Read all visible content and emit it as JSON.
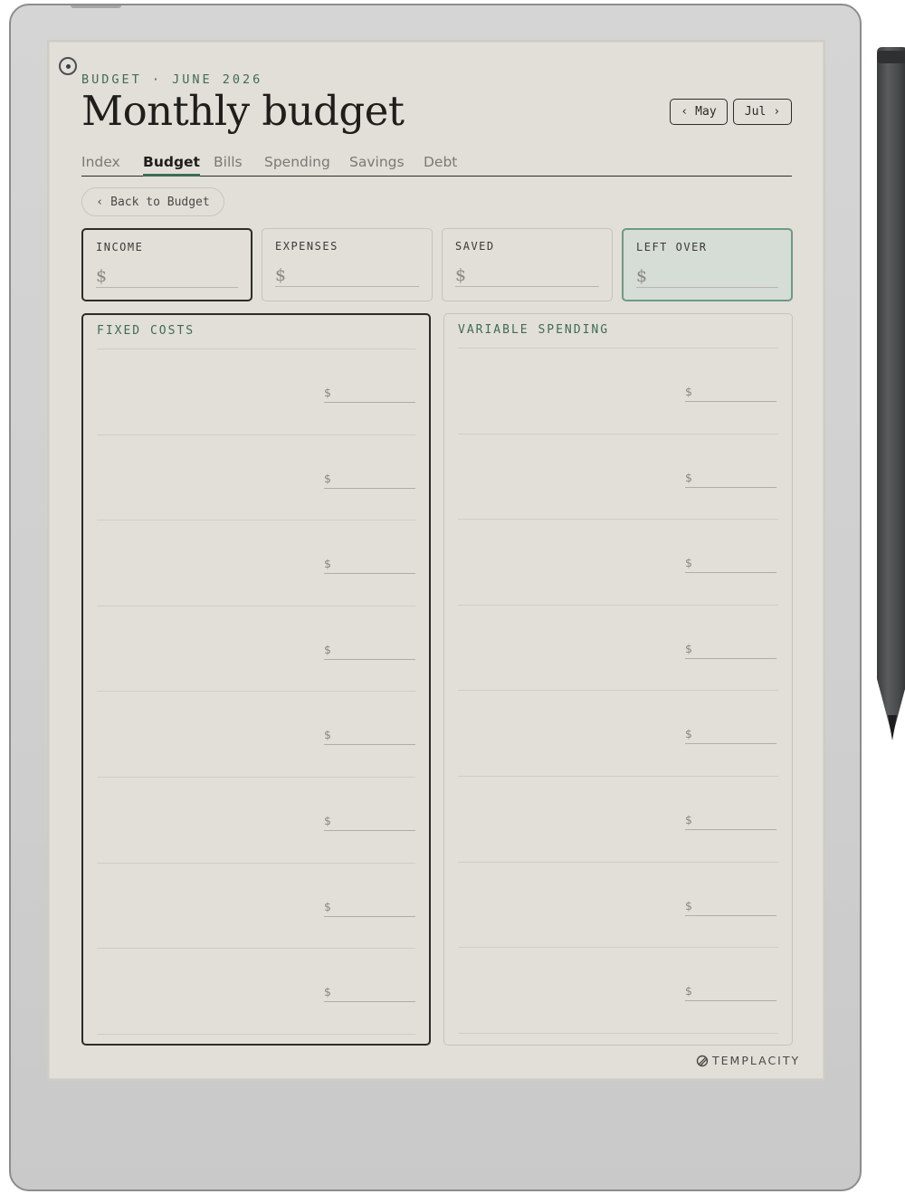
{
  "header": {
    "eyebrow": "BUDGET · JUNE 2026",
    "title": "Monthly budget",
    "prev_label": "May",
    "next_label": "Jul",
    "prev_icon": "chevron-left-icon",
    "next_icon": "chevron-right-icon"
  },
  "tabs": [
    {
      "label": "Index"
    },
    {
      "label": "Budget",
      "active": true
    },
    {
      "label": "Bills"
    },
    {
      "label": "Spending"
    },
    {
      "label": "Savings"
    },
    {
      "label": "Debt"
    }
  ],
  "back_button": {
    "label": "Back to Budget",
    "icon": "chevron-left-icon"
  },
  "summary": [
    {
      "label": "INCOME",
      "currency": "$"
    },
    {
      "label": "EXPENSES",
      "currency": "$"
    },
    {
      "label": "SAVED",
      "currency": "$"
    },
    {
      "label": "LEFT OVER",
      "currency": "$"
    }
  ],
  "panels": {
    "fixed": {
      "title": "FIXED COSTS",
      "currency": "$",
      "row_count": 8
    },
    "variable": {
      "title": "VARIABLE SPENDING",
      "currency": "$",
      "row_count": 8
    }
  },
  "brand": {
    "name": "TEMPLACITY",
    "icon": "templacity-logo-icon"
  },
  "colors": {
    "accent_green": "#3f6b55",
    "paper": "#e2dfd8",
    "ink": "#1f1e1c",
    "left_over_fill": "#d6ddd6"
  }
}
